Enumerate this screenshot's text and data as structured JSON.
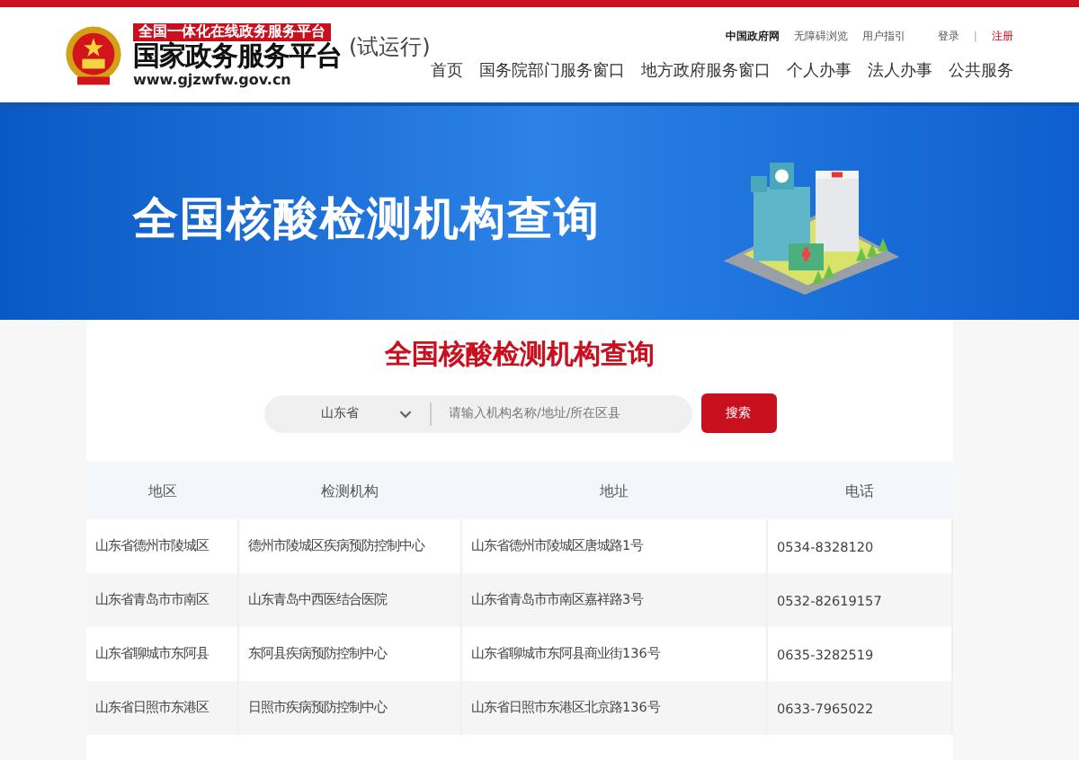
{
  "header": {
    "slogan": "全国一体化在线政务服务平台",
    "site_name": "国家政务服务平台",
    "url": "www.gjzwfw.gov.cn",
    "trial": "(试运行)",
    "top_links": [
      {
        "label": "中国政府网",
        "bold": true
      },
      {
        "label": "无障碍浏览",
        "bold": false
      },
      {
        "label": "用户指引",
        "bold": false
      }
    ],
    "login": "登录",
    "separator": "|",
    "register": "注册",
    "nav": [
      "首页",
      "国务院部门服务窗口",
      "地方政府服务窗口",
      "个人办事",
      "法人办事",
      "公共服务"
    ]
  },
  "banner": {
    "title": "全国核酸检测机构查询"
  },
  "search": {
    "title": "全国核酸检测机构查询",
    "province": "山东省",
    "placeholder": "请输入机构名称/地址/所在区县",
    "button": "搜索"
  },
  "table": {
    "columns": [
      "地区",
      "检测机构",
      "地址",
      "电话"
    ],
    "rows": [
      [
        "山东省德州市陵城区",
        "德州市陵城区疾病预防控制中心",
        "山东省德州市陵城区唐城路1号",
        "0534-8328120"
      ],
      [
        "山东省青岛市市南区",
        "山东青岛中西医结合医院",
        "山东省青岛市市南区嘉祥路3号",
        "0532-82619157"
      ],
      [
        "山东省聊城市东阿县",
        "东阿县疾病预防控制中心",
        "山东省聊城市东阿县商业街136号",
        "0635-3282519"
      ],
      [
        "山东省日照市东港区",
        "日照市疾病预防控制中心",
        "山东省日照市东港区北京路136号",
        "0633-7965022"
      ]
    ]
  }
}
